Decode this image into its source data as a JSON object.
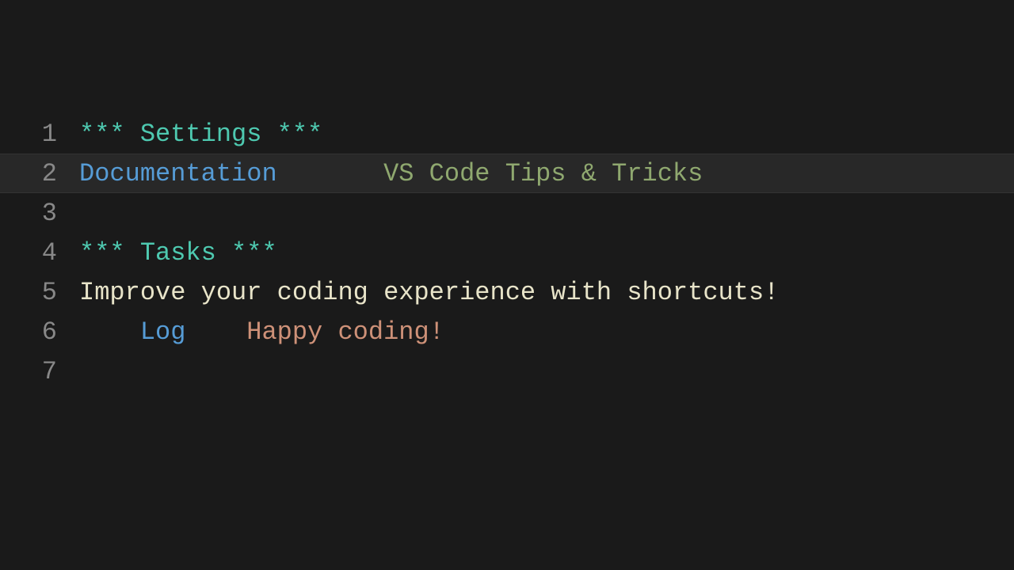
{
  "lines": [
    {
      "num": "1",
      "highlighted": false,
      "segments": [
        {
          "cls": "teal",
          "text": "*** Settings ***"
        }
      ]
    },
    {
      "num": "2",
      "highlighted": true,
      "segments": [
        {
          "cls": "blue",
          "text": "Documentation"
        },
        {
          "cls": "",
          "text": "       "
        },
        {
          "cls": "green",
          "text": "VS Code Tips & Tricks"
        }
      ]
    },
    {
      "num": "3",
      "highlighted": false,
      "segments": []
    },
    {
      "num": "4",
      "highlighted": false,
      "segments": [
        {
          "cls": "teal",
          "text": "*** Tasks ***"
        }
      ]
    },
    {
      "num": "5",
      "highlighted": false,
      "segments": [
        {
          "cls": "cream",
          "text": "Improve your coding experience with shortcuts!"
        }
      ]
    },
    {
      "num": "6",
      "highlighted": false,
      "segments": [
        {
          "cls": "",
          "text": "    "
        },
        {
          "cls": "blue",
          "text": "Log"
        },
        {
          "cls": "",
          "text": "    "
        },
        {
          "cls": "orange",
          "text": "Happy coding!"
        }
      ]
    },
    {
      "num": "7",
      "highlighted": false,
      "segments": []
    }
  ]
}
